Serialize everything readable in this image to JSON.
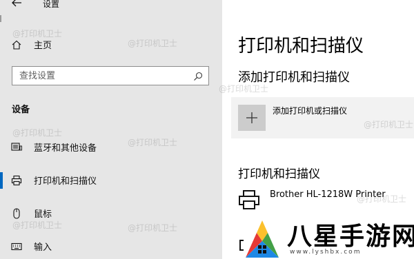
{
  "window": {
    "title": "设置"
  },
  "sidebar": {
    "home_label": "主页",
    "search_placeholder": "查找设置",
    "section_label": "设备",
    "items": [
      {
        "label": "蓝牙和其他设备",
        "icon": "keyboard-device-icon",
        "selected": false
      },
      {
        "label": "打印机和扫描仪",
        "icon": "printer-icon",
        "selected": true
      },
      {
        "label": "鼠标",
        "icon": "mouse-icon",
        "selected": false
      },
      {
        "label": "输入",
        "icon": "keyboard-icon",
        "selected": false
      }
    ]
  },
  "main": {
    "title": "打印机和扫描仪",
    "add_heading": "添加打印机和扫描仪",
    "add_button_label": "添加打印机或扫描仪",
    "list_heading": "打印机和扫描仪",
    "printers": [
      {
        "name": "Brother HL-1218W Printer",
        "icon": "printer-icon"
      }
    ]
  },
  "watermark": {
    "text": "@打印机卫士"
  },
  "logo": {
    "text": "八星手游网",
    "url": "www.lyshbx.com"
  },
  "colors": {
    "accent": "#0067c0",
    "sidebar_bg": "#e6e6e6",
    "button_bg": "#f2f2f2"
  }
}
